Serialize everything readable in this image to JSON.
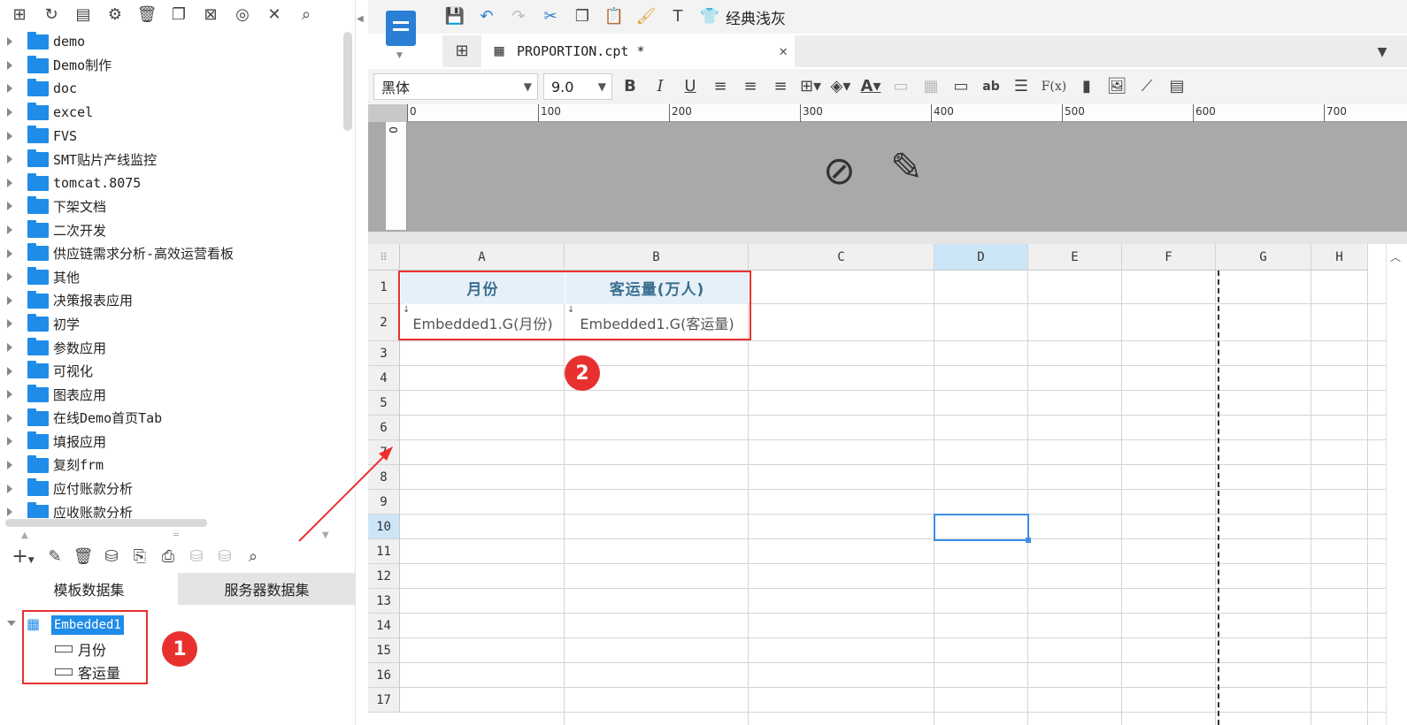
{
  "left_toolbar": {
    "icons": [
      "new-folder-icon",
      "refresh-icon",
      "rename-icon",
      "settings-icon",
      "delete-icon",
      "copy-icon",
      "delete-file-icon",
      "locate-icon",
      "collapse-icon",
      "search-icon"
    ]
  },
  "file_tree": {
    "items": [
      {
        "label": "demo"
      },
      {
        "label": "Demo制作"
      },
      {
        "label": "doc"
      },
      {
        "label": "excel"
      },
      {
        "label": "FVS"
      },
      {
        "label": "SMT贴片产线监控"
      },
      {
        "label": "tomcat.8075"
      },
      {
        "label": "下架文档"
      },
      {
        "label": "二次开发"
      },
      {
        "label": "供应链需求分析-高效运营看板"
      },
      {
        "label": "其他"
      },
      {
        "label": "决策报表应用"
      },
      {
        "label": "初学"
      },
      {
        "label": "参数应用"
      },
      {
        "label": "可视化"
      },
      {
        "label": "图表应用"
      },
      {
        "label": "在线Demo首页Tab"
      },
      {
        "label": "填报应用"
      },
      {
        "label": "复刻frm"
      },
      {
        "label": "应付账款分析"
      },
      {
        "label": "应收账款分析"
      }
    ]
  },
  "dataset_toolbar": {
    "add_label": "+"
  },
  "dataset_tabs": [
    {
      "label": "模板数据集",
      "active": true
    },
    {
      "label": "服务器数据集",
      "active": false
    }
  ],
  "dataset_tree": {
    "dataset": "Embedded1",
    "fields": [
      {
        "label": "月份"
      },
      {
        "label": "客运量"
      }
    ]
  },
  "badges": {
    "one": "1",
    "two": "2"
  },
  "top_toolbar": {
    "theme_label": "经典浅灰"
  },
  "tab": {
    "title": "PROPORTION.cpt *"
  },
  "format_toolbar": {
    "font": "黑体",
    "size": "9.0",
    "bold": "B",
    "italic": "I",
    "underline": "U",
    "ab": "ab",
    "fx": "F(x)"
  },
  "ruler": {
    "ticks": [
      "0",
      "100",
      "200",
      "300",
      "400",
      "500",
      "600",
      "700"
    ],
    "v": "0"
  },
  "sheet": {
    "columns": [
      "A",
      "B",
      "C",
      "D",
      "E",
      "F",
      "G",
      "H"
    ],
    "rows": [
      "1",
      "2",
      "3",
      "4",
      "5",
      "6",
      "7",
      "8",
      "9",
      "10",
      "11",
      "12",
      "13",
      "14",
      "15",
      "16",
      "17"
    ],
    "a1": "月份",
    "b1": "客运量(万人)",
    "a2": "Embedded1.G(月份)",
    "b2": "Embedded1.G(客运量)"
  },
  "colors": {
    "accent": "#1f8ce8",
    "annotation": "#e8312f",
    "header_fill": "#e6f0f8"
  }
}
